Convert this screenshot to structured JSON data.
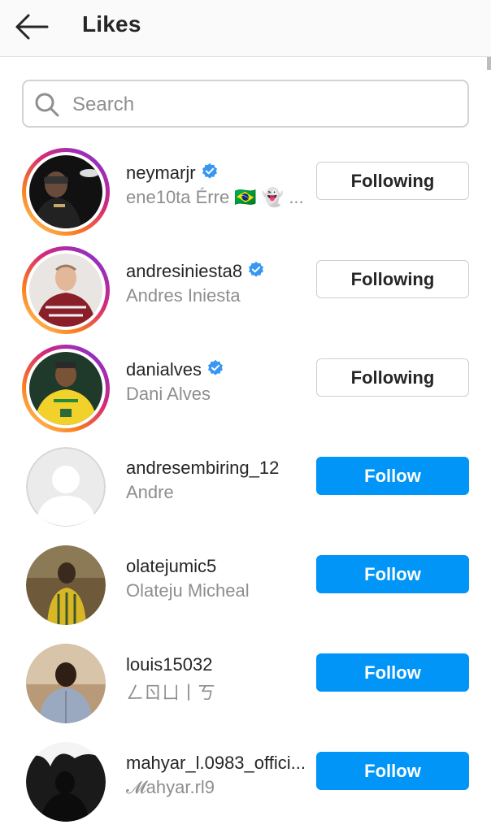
{
  "header": {
    "title": "Likes",
    "back_icon": "arrow-left-icon"
  },
  "search": {
    "placeholder": "Search",
    "value": "",
    "icon": "search-icon"
  },
  "colors": {
    "accent": "#0095f6",
    "verified": "#3897f0",
    "muted_text": "#8e8e8e"
  },
  "likes": [
    {
      "username": "neymarjr",
      "full_name": "ene10ta Érre 🇧🇷 👻 ...",
      "verified": true,
      "story_ring": true,
      "button": "Following"
    },
    {
      "username": "andresiniesta8",
      "full_name": "Andres Iniesta",
      "verified": true,
      "story_ring": true,
      "button": "Following"
    },
    {
      "username": "danialves",
      "full_name": "Dani Alves",
      "verified": true,
      "story_ring": true,
      "button": "Following"
    },
    {
      "username": "andresembiring_12",
      "full_name": "Andre",
      "verified": false,
      "story_ring": false,
      "button": "Follow"
    },
    {
      "username": "olatejumic5",
      "full_name": "Olateju Micheal",
      "verified": false,
      "story_ring": false,
      "button": "Follow"
    },
    {
      "username": "louis15032",
      "full_name": "ㄥㄖㄩ丨ㄎ",
      "verified": false,
      "story_ring": false,
      "button": "Follow"
    },
    {
      "username": "mahyar_l.0983_offici...",
      "full_name": "𝓜ahyar.rl9",
      "verified": false,
      "story_ring": false,
      "button": "Follow"
    }
  ]
}
